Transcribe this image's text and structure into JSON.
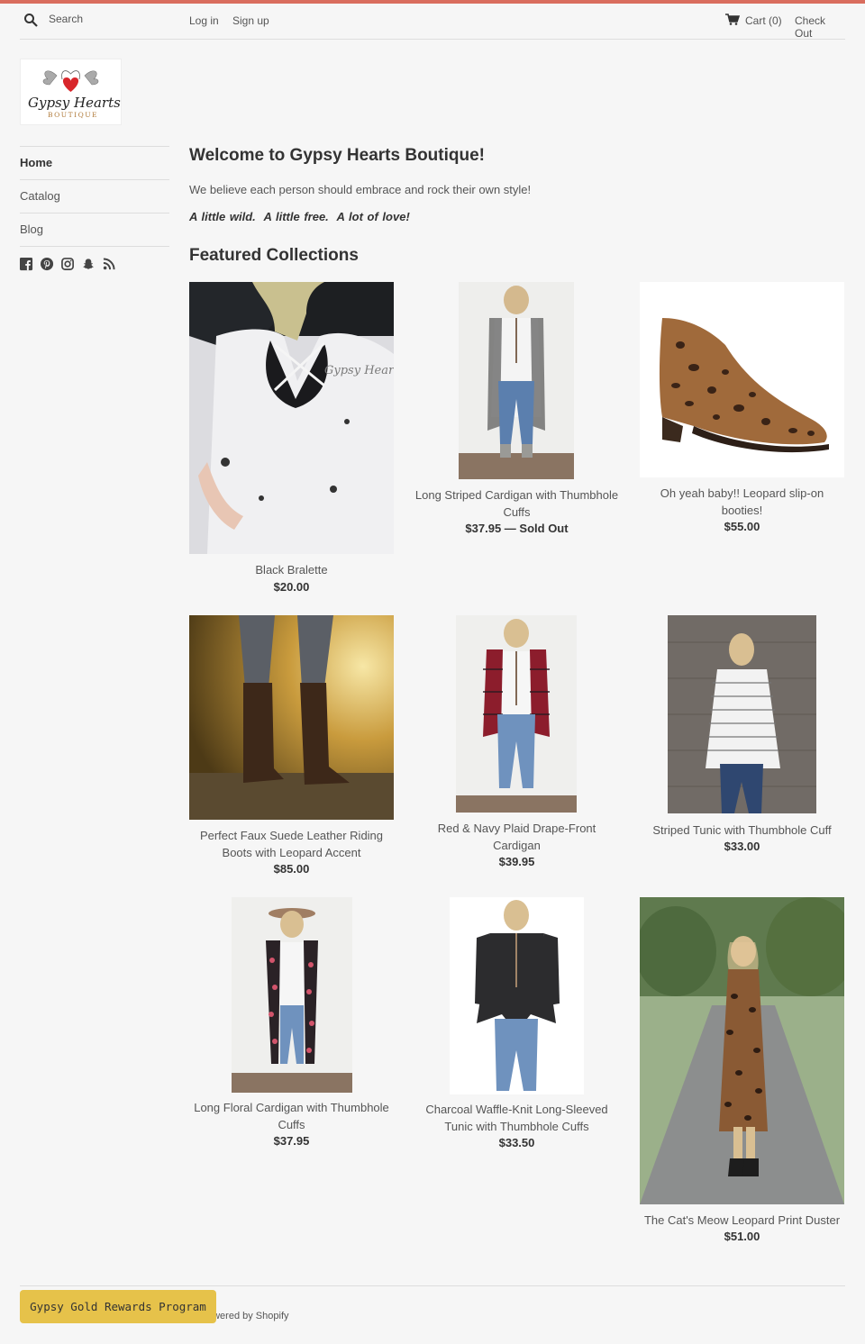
{
  "header": {
    "search_placeholder": "Search",
    "login": "Log in",
    "signup": "Sign up",
    "cart": "Cart (0)",
    "checkout": "Check Out"
  },
  "logo": {
    "line1": "Gypsy Hearts",
    "line2": "BOUTIQUE"
  },
  "sidebar": {
    "items": [
      {
        "label": "Home"
      },
      {
        "label": "Catalog"
      },
      {
        "label": "Blog"
      }
    ],
    "social_icons": [
      "facebook-icon",
      "pinterest-icon",
      "instagram-icon",
      "snapchat-icon",
      "rss-icon"
    ]
  },
  "main": {
    "welcome_title": "Welcome to Gypsy Hearts Boutique!",
    "welcome_text": "We believe each person should embrace and rock their own style!",
    "tagline": "A little wild.  A little free.  A lot of love!",
    "featured_title": "Featured Collections"
  },
  "products": [
    {
      "title": "Black Bralette",
      "price": "$20.00",
      "sold_out": ""
    },
    {
      "title": "Long Striped Cardigan with Thumbhole Cuffs",
      "price": "$37.95",
      "sold_out": " — Sold Out"
    },
    {
      "title": "Oh yeah baby!! Leopard slip-on booties!",
      "price": "$55.00",
      "sold_out": ""
    },
    {
      "title": "Perfect Faux Suede Leather Riding Boots with Leopard Accent",
      "price": "$85.00",
      "sold_out": ""
    },
    {
      "title": "Red & Navy Plaid Drape-Front Cardigan",
      "price": "$39.95",
      "sold_out": ""
    },
    {
      "title": "Striped Tunic with Thumbhole Cuff",
      "price": "$33.00",
      "sold_out": ""
    },
    {
      "title": "Long Floral Cardigan with Thumbhole Cuffs",
      "price": "$37.95",
      "sold_out": ""
    },
    {
      "title": "Charcoal Waffle-Knit Long-Sleeved Tunic with Thumbhole Cuffs",
      "price": "$33.50",
      "sold_out": ""
    },
    {
      "title": "The Cat's Meow Leopard Print Duster",
      "price": "$51.00",
      "sold_out": ""
    }
  ],
  "footer": {
    "powered": "owered by Shopify",
    "rewards_button": "Gypsy Gold Rewards Program"
  },
  "colors": {
    "accent_bar": "#d96d5e",
    "rewards_button": "#e6c24a",
    "background": "#f6f6f6"
  }
}
